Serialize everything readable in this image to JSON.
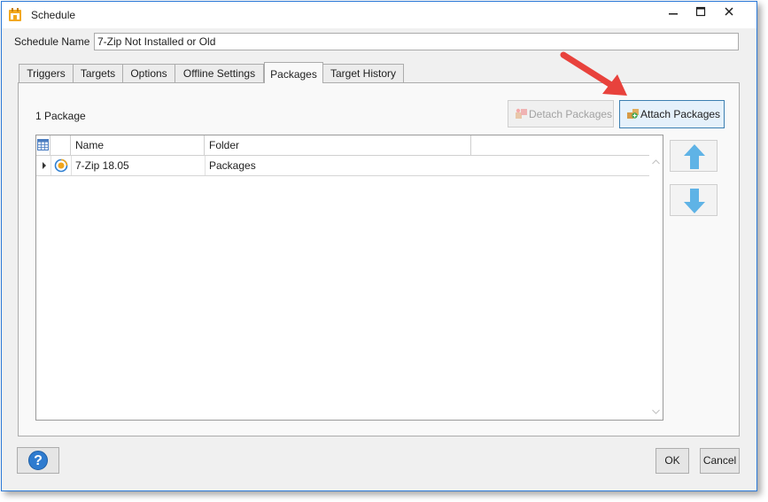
{
  "window": {
    "title": "Schedule",
    "icon": "schedule-app-icon",
    "controls": {
      "minimize": "minimize-icon",
      "maximize": "maximize-icon",
      "close": "close-icon"
    },
    "accent_color": "#2b79d7"
  },
  "schedule_name": {
    "label": "Schedule Name",
    "value": "7-Zip Not Installed or Old"
  },
  "tabs": [
    {
      "label": "Triggers",
      "active": false
    },
    {
      "label": "Targets",
      "active": false
    },
    {
      "label": "Options",
      "active": false
    },
    {
      "label": "Offline Settings",
      "active": false
    },
    {
      "label": "Packages",
      "active": true
    },
    {
      "label": "Target History",
      "active": false
    }
  ],
  "packages": {
    "count_text": "1 Package",
    "detach_label": "Detach Packages",
    "detach_enabled": false,
    "attach_label": "Attach Packages",
    "columns": [
      "Name",
      "Folder"
    ],
    "rows": [
      {
        "name": "7-Zip 18.05",
        "folder": "Packages",
        "icon": "package-icon"
      }
    ],
    "move_up_icon": "arrow-up-icon",
    "move_down_icon": "arrow-down-icon"
  },
  "annotation": {
    "type": "arrow",
    "color": "#e8423c",
    "points_to": "Attach Packages"
  },
  "footer": {
    "help_icon": "help-icon",
    "help_glyph": "?",
    "ok_label": "OK",
    "cancel_label": "Cancel"
  }
}
